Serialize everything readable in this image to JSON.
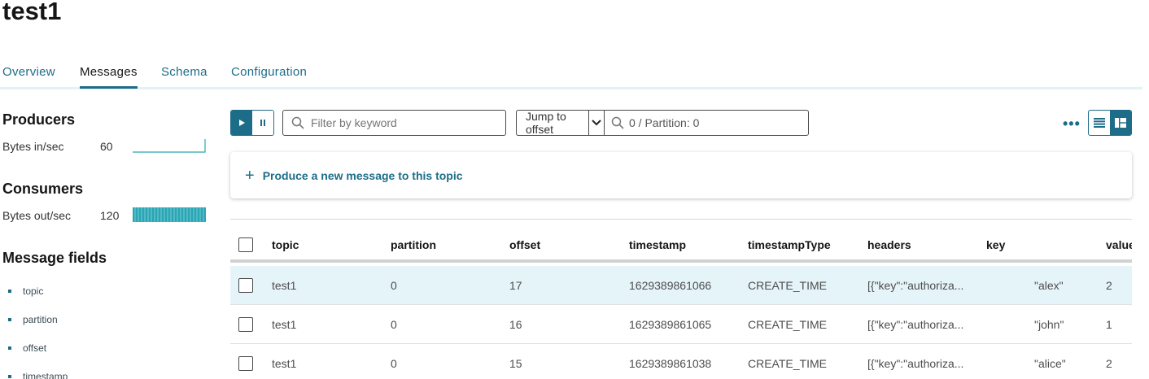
{
  "title": "test1",
  "tabs": [
    {
      "label": "Overview"
    },
    {
      "label": "Messages"
    },
    {
      "label": "Schema"
    },
    {
      "label": "Configuration"
    }
  ],
  "sidebar": {
    "producers": {
      "heading": "Producers",
      "metric_label": "Bytes in/sec",
      "metric_value": "60"
    },
    "consumers": {
      "heading": "Consumers",
      "metric_label": "Bytes out/sec",
      "metric_value": "120"
    },
    "fields_heading": "Message fields",
    "fields": [
      "topic",
      "partition",
      "offset",
      "timestamp"
    ]
  },
  "toolbar": {
    "filter_placeholder": "Filter by keyword",
    "jump_select": "Jump to offset",
    "offset_value": "0 / Partition: 0"
  },
  "produce": {
    "label": "Produce a new message to this topic"
  },
  "table": {
    "columns": [
      "topic",
      "partition",
      "offset",
      "timestamp",
      "timestampType",
      "headers",
      "key",
      "value"
    ],
    "rows": [
      [
        "test1",
        "0",
        "17",
        "1629389861066",
        "CREATE_TIME",
        "[{\"key\":\"authoriza...",
        "\"alex\"",
        "2"
      ],
      [
        "test1",
        "0",
        "16",
        "1629389861065",
        "CREATE_TIME",
        "[{\"key\":\"authoriza...",
        "\"john\"",
        "1"
      ],
      [
        "test1",
        "0",
        "15",
        "1629389861038",
        "CREATE_TIME",
        "[{\"key\":\"authoriza...",
        "\"alice\"",
        "2"
      ]
    ]
  },
  "colors": {
    "accent": "#1d6d89",
    "row_highlight": "#e5f4f9",
    "spark": "#28a6b4"
  },
  "icons": [
    "play-icon",
    "pause-icon",
    "search-icon",
    "chevron-down-icon",
    "more-icon",
    "list-view-icon",
    "split-view-icon",
    "plus-icon"
  ]
}
